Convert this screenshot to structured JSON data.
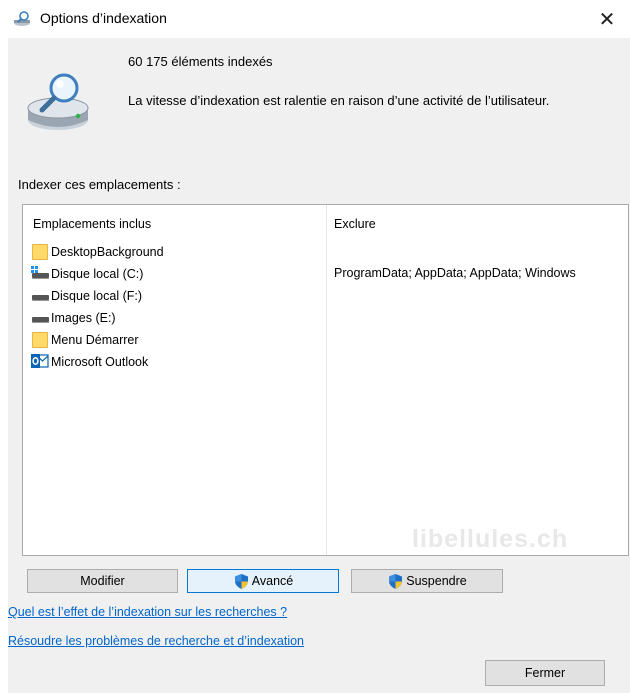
{
  "window": {
    "title": "Options d’indexation",
    "close_glyph": "✕"
  },
  "summary": {
    "count": "60 175 éléments indexés",
    "status": "La vitesse d’indexation est ralentie en raison d’une activité de l’utilisateur."
  },
  "locations": {
    "section_label": "Indexer ces emplacements :",
    "included_header": "Emplacements inclus",
    "exclude_header": "Exclure",
    "items": [
      {
        "label": "DesktopBackground",
        "icon": "folder-icon"
      },
      {
        "label": "Disque local (C:)",
        "icon": "system-drive-icon",
        "exclude": "ProgramData; AppData; AppData; Windows"
      },
      {
        "label": "Disque local (F:)",
        "icon": "drive-icon"
      },
      {
        "label": "Images (E:)",
        "icon": "drive-icon"
      },
      {
        "label": "Menu Démarrer",
        "icon": "folder-icon"
      },
      {
        "label": "Microsoft Outlook",
        "icon": "outlook-icon"
      }
    ],
    "watermark": "libellules.ch"
  },
  "buttons": {
    "modifier": "Modifier",
    "avance": "Avancé",
    "suspendre": "Suspendre",
    "fermer": "Fermer"
  },
  "links": {
    "effect": "Quel est l’effet de l’indexation sur les recherches ?",
    "troubleshoot": "Résoudre les problèmes de recherche et d’indexation"
  },
  "colors": {
    "accent": "#0078d7",
    "link": "#0066cc",
    "dialog_bg": "#f0f0f0"
  }
}
